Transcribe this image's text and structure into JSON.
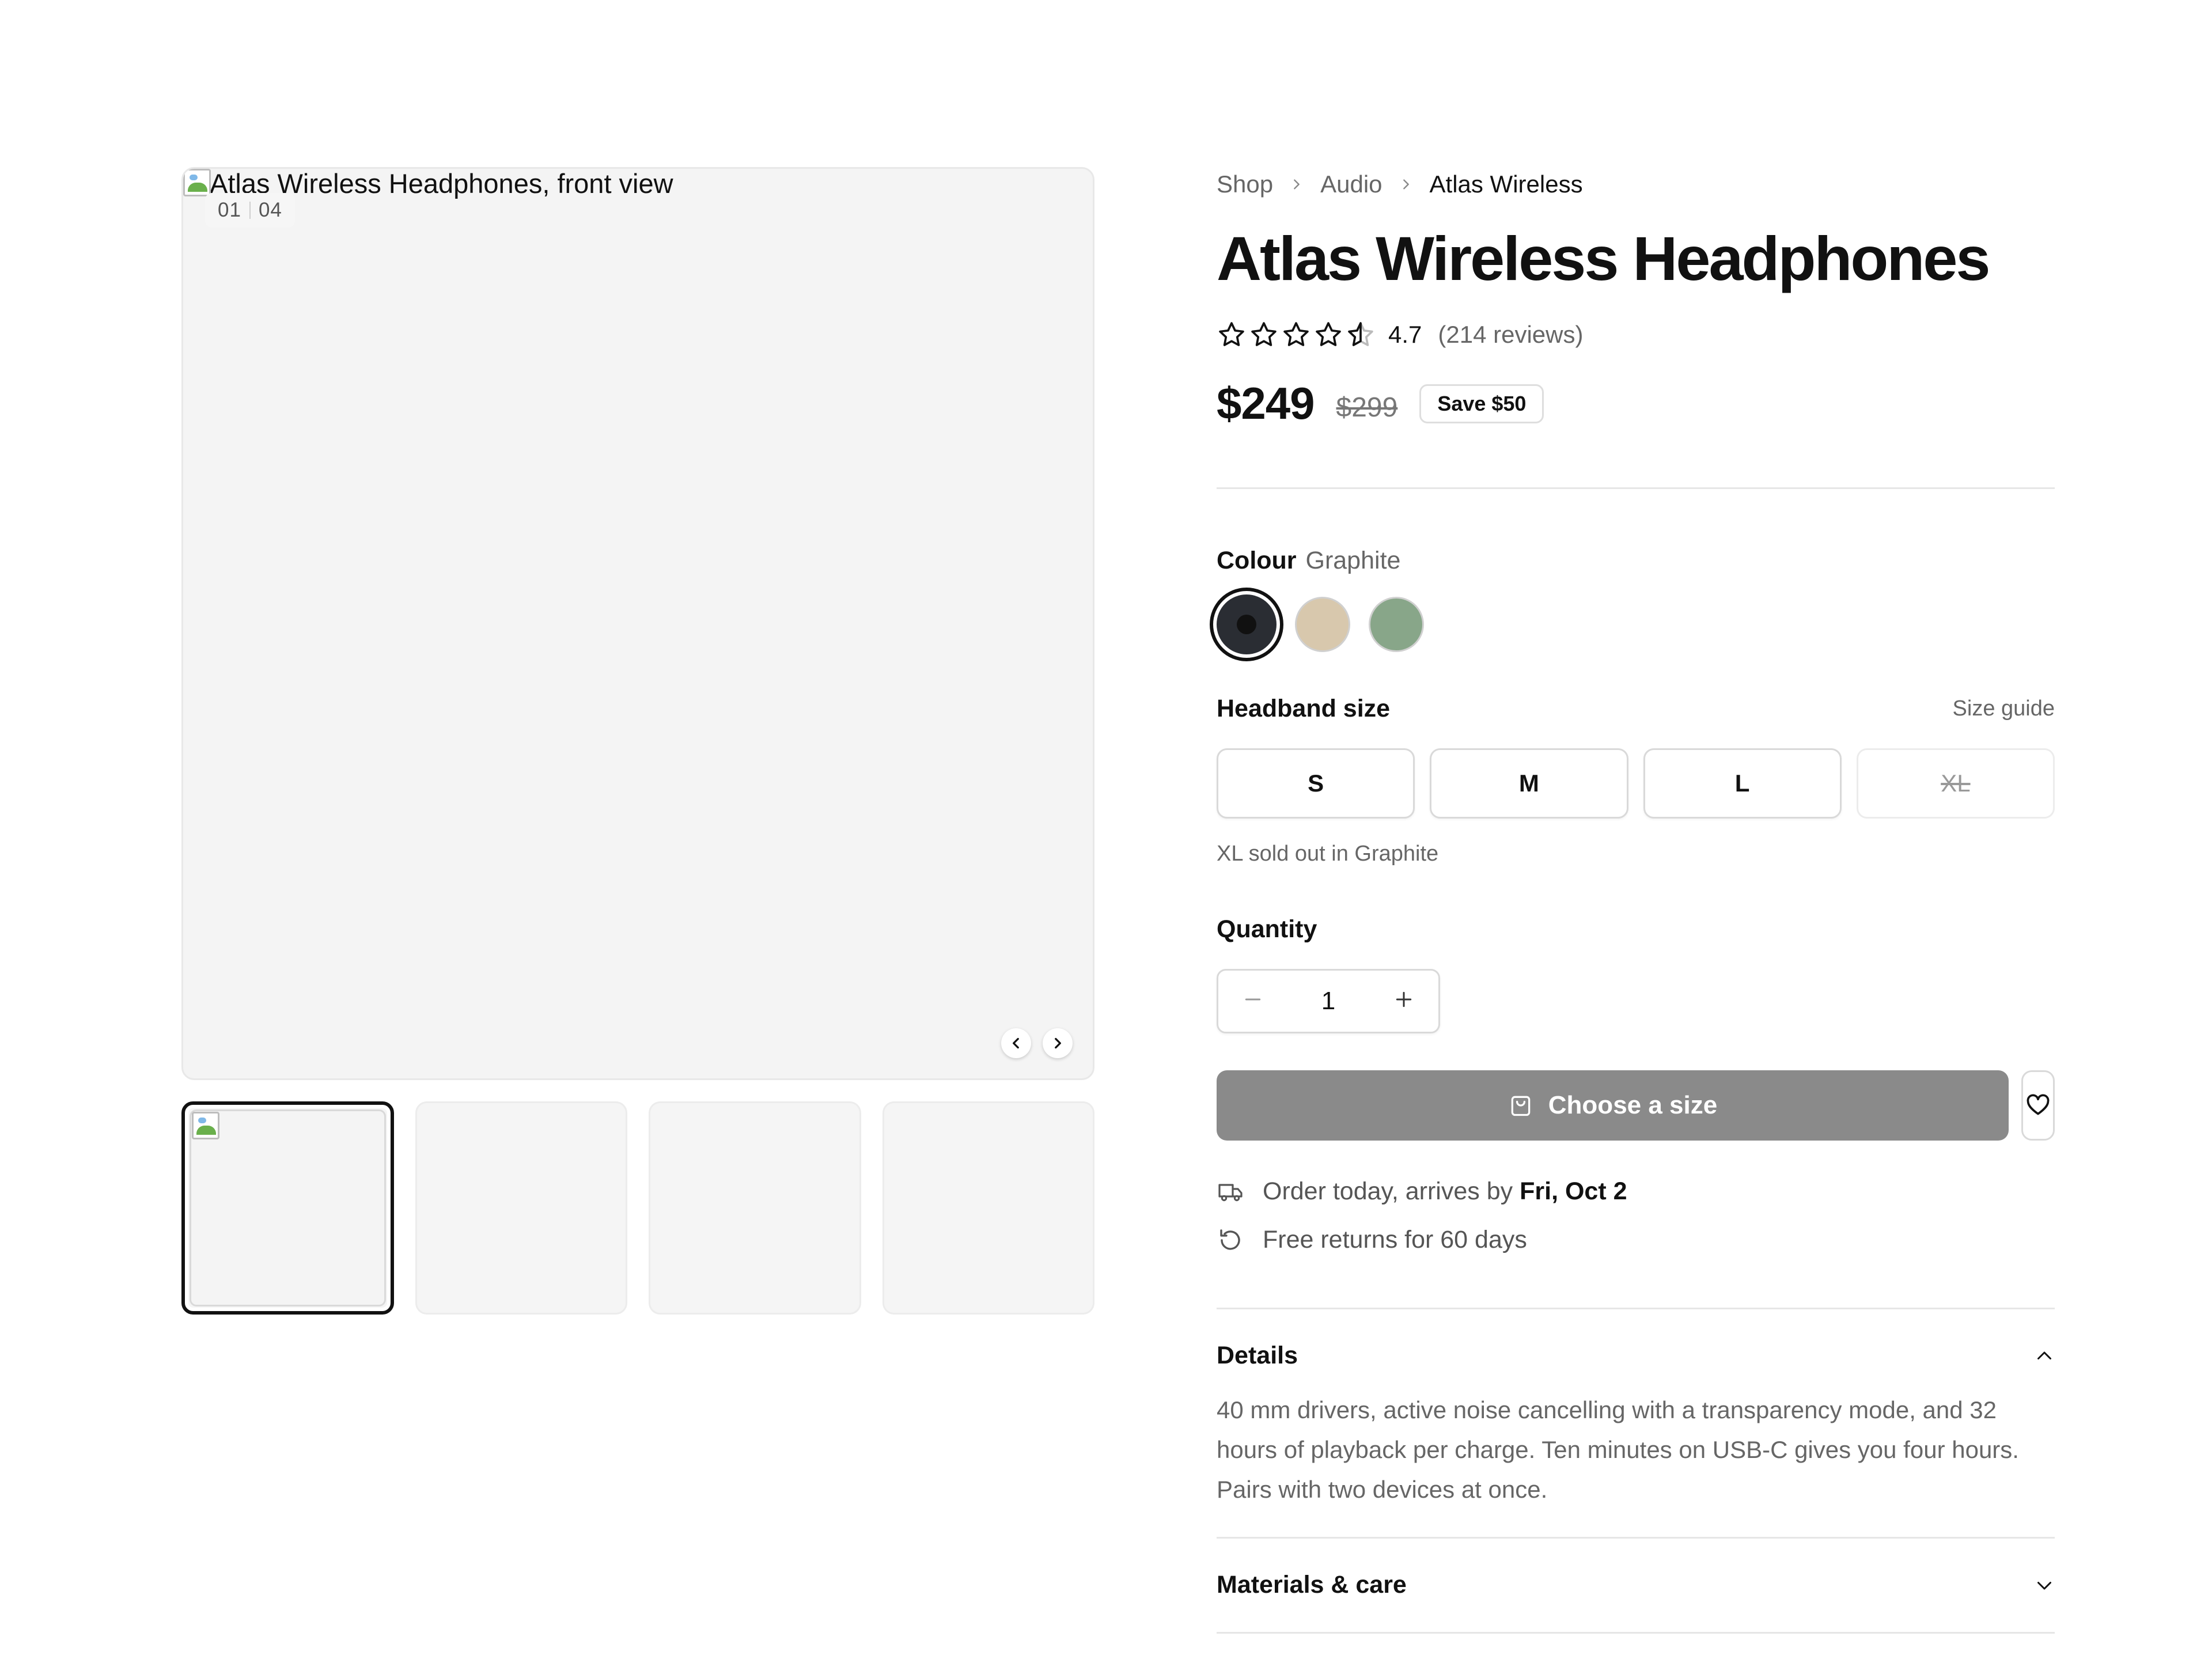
{
  "gallery": {
    "main_image_alt": "Atlas Wireless Headphones, front view",
    "counter_current": "01",
    "counter_total": "04",
    "thumbnail_count": 4
  },
  "breadcrumb": [
    "Shop",
    "Audio",
    "Atlas Wireless"
  ],
  "product": {
    "title": "Atlas Wireless Headphones",
    "rating": "4.7",
    "rating_value": 4.7,
    "reviews": "(214 reviews)",
    "price": "$249",
    "old_price": "$299",
    "save_badge": "Save $50"
  },
  "colour": {
    "label": "Colour",
    "selected": "Graphite",
    "options": [
      {
        "name": "Graphite",
        "hex": "#2a2d33"
      },
      {
        "name": "Sand",
        "hex": "#d8c8ad"
      },
      {
        "name": "Sage",
        "hex": "#88a689"
      }
    ]
  },
  "size": {
    "label": "Headband size",
    "guide_link": "Size guide",
    "options": [
      "S",
      "M",
      "L",
      "XL"
    ],
    "sold_out": "XL",
    "note": "XL sold out in Graphite"
  },
  "quantity": {
    "label": "Quantity",
    "value": "1"
  },
  "cta": {
    "label": "Choose a size",
    "color": "#8a8a8a"
  },
  "shipping": {
    "delivery_prefix": "Order today, arrives by",
    "delivery_date": "Fri, Oct 2",
    "returns": "Free returns for 60 days"
  },
  "accordion": {
    "details_title": "Details",
    "details_body": "40 mm drivers, active noise cancelling with a transparency mode, and 32 hours of playback per charge. Ten minutes on USB-C gives you four hours. Pairs with two devices at once.",
    "materials_title": "Materials & care"
  },
  "icons": [
    "chevron-right-icon",
    "star-icon",
    "star-half-icon",
    "minus-icon",
    "plus-icon",
    "bag-icon",
    "heart-icon",
    "truck-icon",
    "return-icon",
    "chevron-up-icon",
    "chevron-down-icon",
    "chevron-left-icon"
  ]
}
